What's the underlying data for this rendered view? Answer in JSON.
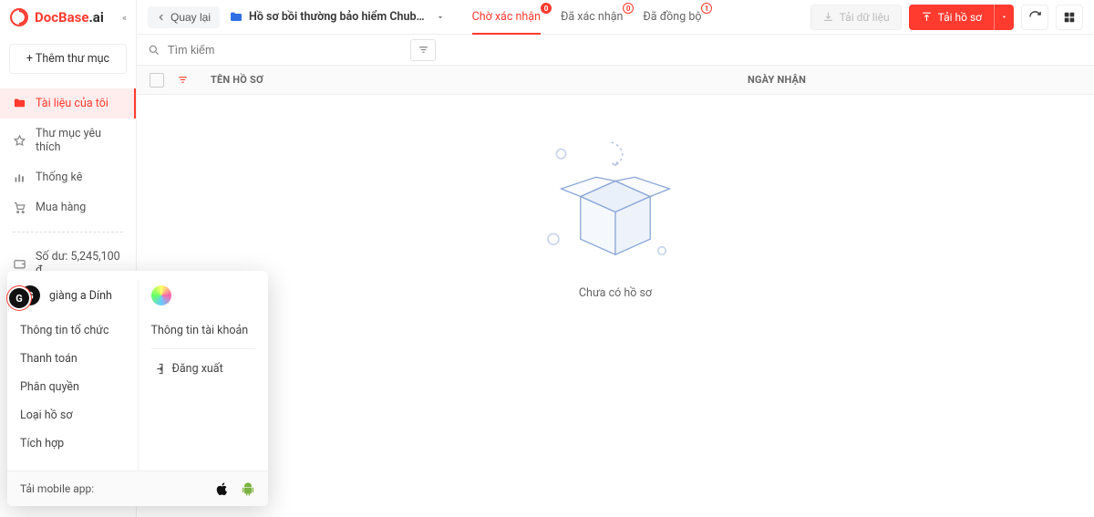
{
  "brand": {
    "name_red": "DocBase",
    "name_dark": ".ai",
    "collapse_glyph": "«"
  },
  "sidebar": {
    "add_folder": "+  Thêm thư mục",
    "items": [
      {
        "label": "Tài liệu của tôi",
        "icon": "folder-icon",
        "active": true
      },
      {
        "label": "Thư mục yêu thích",
        "icon": "star-icon"
      },
      {
        "label": "Thống kê",
        "icon": "stats-icon"
      },
      {
        "label": "Mua hàng",
        "icon": "cart-icon"
      }
    ],
    "balance_label": "Số dư: 5,245,100 đ"
  },
  "header": {
    "back": "Quay lại",
    "folder_name": "Hồ sơ bồi thường bảo hiểm Chub…",
    "tabs": [
      {
        "label": "Chờ xác nhận",
        "badge": "0",
        "style": "red",
        "active": true
      },
      {
        "label": "Đã xác nhận",
        "badge": "0",
        "style": "outline"
      },
      {
        "label": "Đã đồng bộ",
        "badge": "1",
        "style": "outline"
      }
    ],
    "download_data": "Tải dữ liệu",
    "upload": "Tải hồ sơ"
  },
  "search": {
    "placeholder": "Tìm kiếm"
  },
  "table": {
    "col_name": "TÊN HỒ SƠ",
    "col_date": "NGÀY NHẬN"
  },
  "empty": {
    "text": "Chưa có hồ sơ"
  },
  "popover": {
    "org_name": "giàng a Dính",
    "org_initial": "G",
    "left": [
      "Thông tin tổ chức",
      "Thanh toán",
      "Phân quyền",
      "Loại hồ sơ",
      "Tích hợp"
    ],
    "right_top": "Thông tin tài khoản",
    "logout": "Đăng xuất",
    "footer": "Tải mobile app:"
  }
}
